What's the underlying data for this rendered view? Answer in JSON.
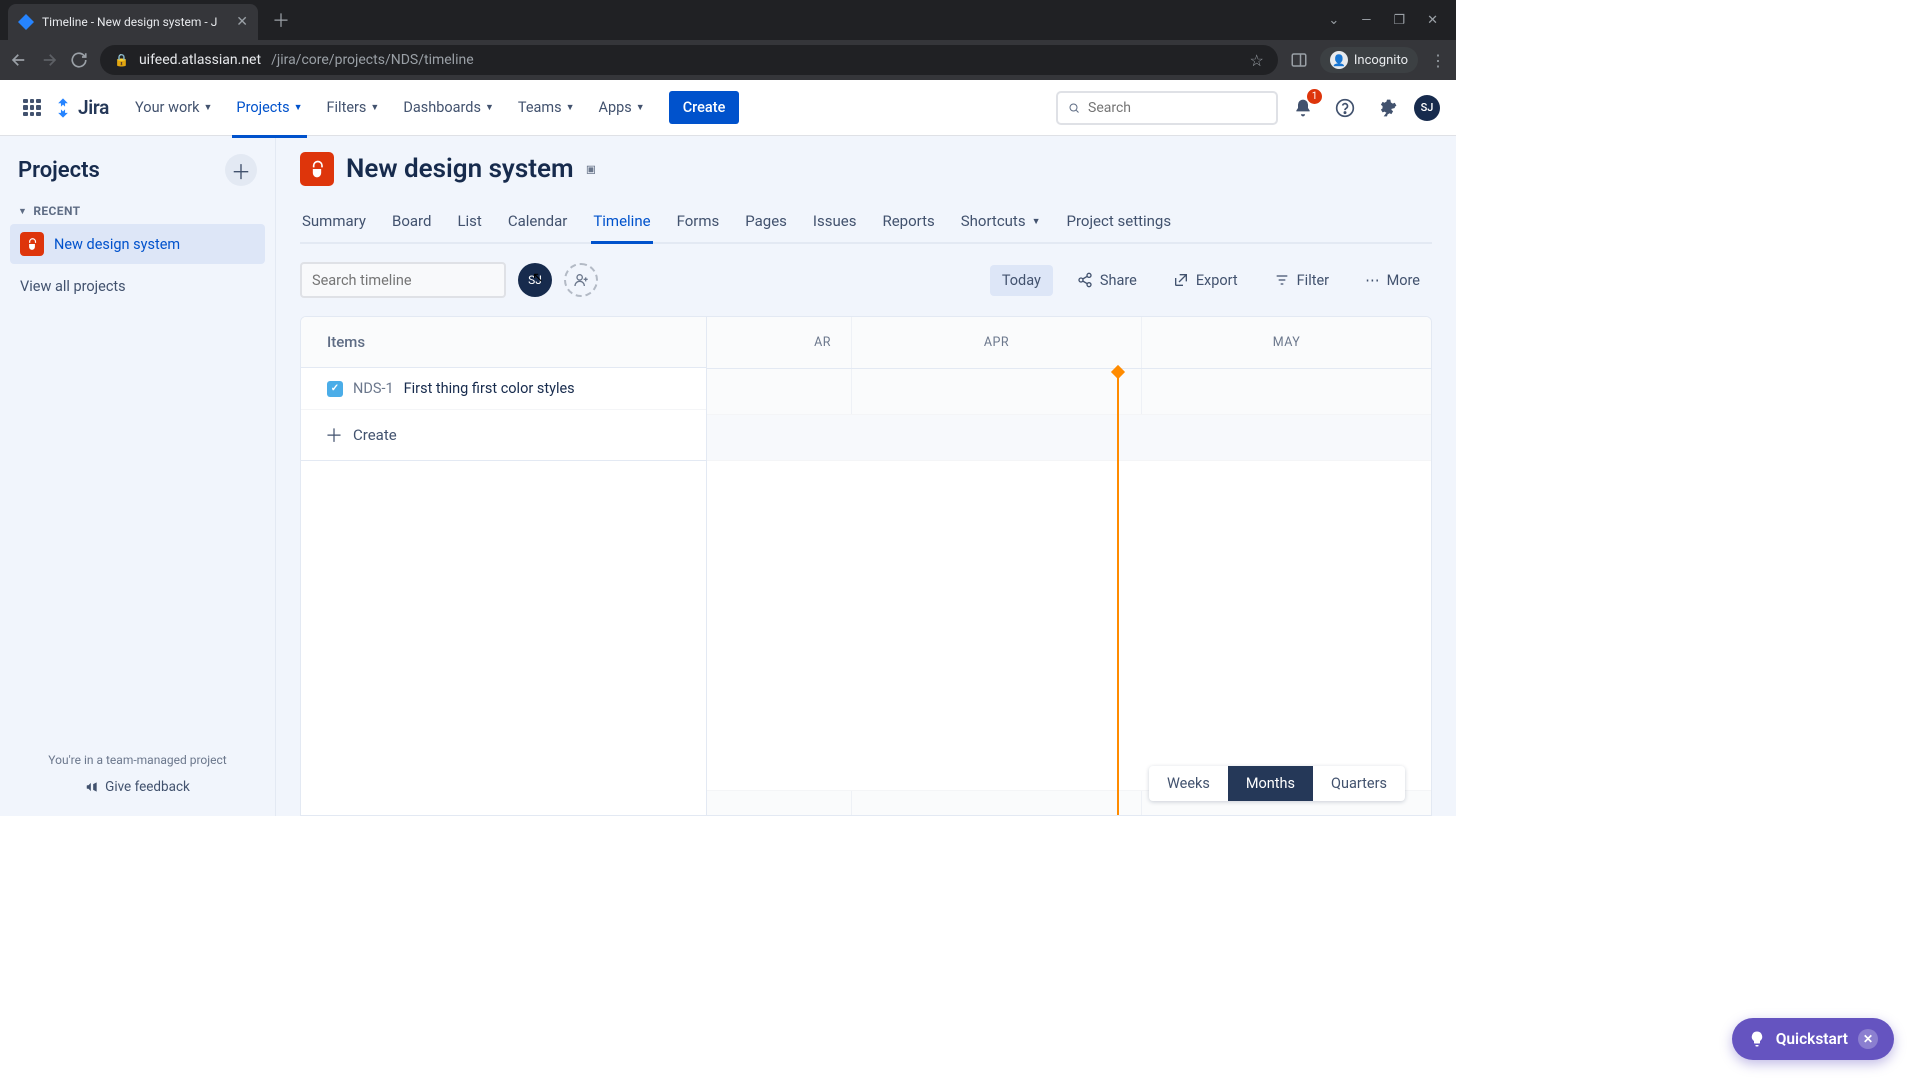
{
  "browser": {
    "tab_title": "Timeline - New design system - J",
    "url_host": "uifeed.atlassian.net",
    "url_path": "/jira/core/projects/NDS/timeline",
    "incognito_label": "Incognito"
  },
  "nav": {
    "product": "Jira",
    "items": [
      "Your work",
      "Projects",
      "Filters",
      "Dashboards",
      "Teams",
      "Apps"
    ],
    "active_index": 1,
    "create_label": "Create",
    "search_placeholder": "Search",
    "notif_count": "1",
    "avatar_initials": "SJ"
  },
  "sidebar": {
    "title": "Projects",
    "section_label": "RECENT",
    "items": [
      {
        "name": "New design system",
        "selected": true
      }
    ],
    "view_all_label": "View all projects",
    "team_managed_msg": "You're in a team-managed project",
    "feedback_label": "Give feedback"
  },
  "project": {
    "name": "New design system",
    "tabs": [
      "Summary",
      "Board",
      "List",
      "Calendar",
      "Timeline",
      "Forms",
      "Pages",
      "Issues",
      "Reports",
      "Shortcuts",
      "Project settings"
    ],
    "active_tab_index": 4
  },
  "toolbar": {
    "search_placeholder": "Search timeline",
    "avatar_initials": "SJ",
    "today_label": "Today",
    "share_label": "Share",
    "export_label": "Export",
    "filter_label": "Filter",
    "more_label": "More"
  },
  "timeline": {
    "items_header": "Items",
    "create_label": "Create",
    "months": [
      "AR",
      "APR",
      "MAY"
    ],
    "rows": [
      {
        "key": "NDS-1",
        "summary": "First thing first color styles"
      }
    ],
    "zoom_options": [
      "Weeks",
      "Months",
      "Quarters"
    ],
    "zoom_selected_index": 1
  },
  "quickstart": {
    "label": "Quickstart"
  }
}
